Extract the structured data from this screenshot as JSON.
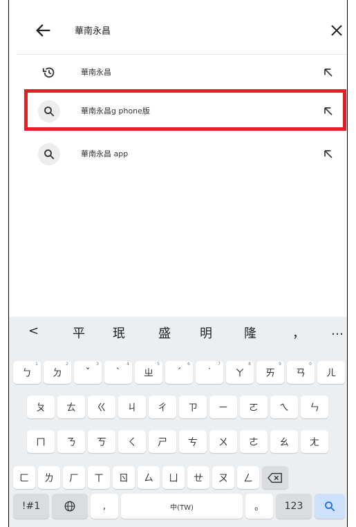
{
  "search": {
    "query": "華南永昌"
  },
  "suggestions": [
    {
      "icon": "history-icon",
      "text": "華南永昌"
    },
    {
      "icon": "search-icon",
      "text": "華南永昌g phone版"
    },
    {
      "icon": "search-icon",
      "text": "華南永昌 app"
    }
  ],
  "keyboard": {
    "candidates": [
      "<",
      "平",
      "珉",
      "盛",
      "明",
      "隆",
      "，",
      "…"
    ],
    "row1": [
      {
        "k": "ㄅ",
        "s": "1"
      },
      {
        "k": "ㄉ",
        "s": "2"
      },
      {
        "k": "ˇ",
        "s": "3"
      },
      {
        "k": "ˋ",
        "s": "4"
      },
      {
        "k": "ㄓ",
        "s": "5"
      },
      {
        "k": "ˊ",
        "s": "6"
      },
      {
        "k": "˙",
        "s": "7"
      },
      {
        "k": "ㄚ",
        "s": "8"
      },
      {
        "k": "ㄞ",
        "s": "9"
      },
      {
        "k": "ㄢ",
        "s": "0"
      },
      {
        "k": "ㄦ",
        "s": ""
      }
    ],
    "row2": [
      "ㄆ",
      "ㄊ",
      "ㄍ",
      "ㄐ",
      "ㄔ",
      "ㄗ",
      "ㄧ",
      "ㄛ",
      "ㄟ",
      "ㄣ"
    ],
    "row3": [
      "ㄇ",
      "ㄋ",
      "ㄎ",
      "ㄑ",
      "ㄕ",
      "ㄘ",
      "ㄨ",
      "ㄜ",
      "ㄠ",
      "ㄤ"
    ],
    "row4": [
      "ㄈ",
      "ㄌ",
      "ㄏ",
      "ㄒ",
      "ㄖ",
      "ㄙ",
      "ㄩ",
      "ㄝ",
      "ㄡ",
      "ㄥ"
    ],
    "symbols_label": "!#1",
    "comma_label": ",",
    "space_label": "中(TW)",
    "period_label": "。",
    "numbers_label": "123"
  }
}
